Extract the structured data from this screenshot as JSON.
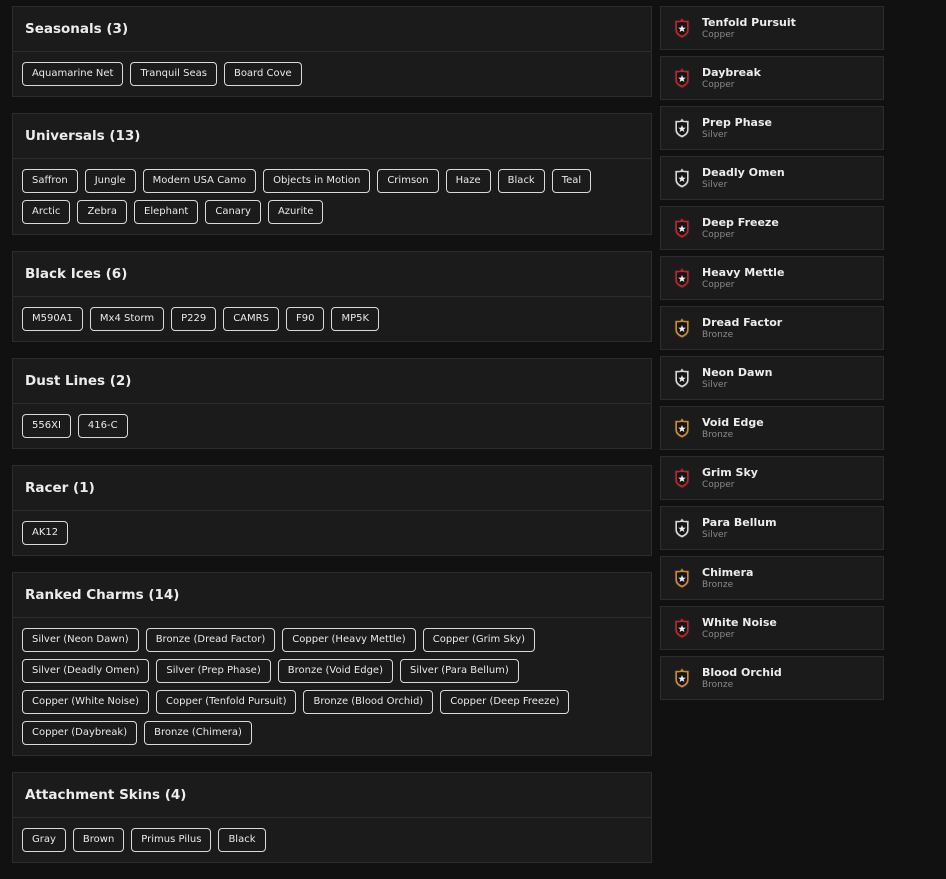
{
  "sections": [
    {
      "title": "Seasonals (3)",
      "items": [
        "Aquamarine Net",
        "Tranquil Seas",
        "Board Cove"
      ]
    },
    {
      "title": "Universals (13)",
      "items": [
        "Saffron",
        "Jungle",
        "Modern USA Camo",
        "Objects in Motion",
        "Crimson",
        "Haze",
        "Black",
        "Teal",
        "Arctic",
        "Zebra",
        "Elephant",
        "Canary",
        "Azurite"
      ]
    },
    {
      "title": "Black Ices (6)",
      "items": [
        "M590A1",
        "Mx4 Storm",
        "P229",
        "CAMRS",
        "F90",
        "MP5K"
      ]
    },
    {
      "title": "Dust Lines (2)",
      "items": [
        "556XI",
        "416-C"
      ]
    },
    {
      "title": "Racer (1)",
      "items": [
        "AK12"
      ]
    },
    {
      "title": "Ranked Charms (14)",
      "items": [
        "Silver (Neon Dawn)",
        "Bronze (Dread Factor)",
        "Copper (Heavy Mettle)",
        "Copper (Grim Sky)",
        "Silver (Deadly Omen)",
        "Silver (Prep Phase)",
        "Bronze (Void Edge)",
        "Silver (Para Bellum)",
        "Copper (White Noise)",
        "Copper (Tenfold Pursuit)",
        "Bronze (Blood Orchid)",
        "Copper (Deep Freeze)",
        "Copper (Daybreak)",
        "Bronze (Chimera)"
      ]
    },
    {
      "title": "Attachment Skins (4)",
      "items": [
        "Gray",
        "Brown",
        "Primus Pilus",
        "Black"
      ]
    }
  ],
  "charms": [
    {
      "name": "Tenfold Pursuit",
      "tier": "Copper"
    },
    {
      "name": "Daybreak",
      "tier": "Copper"
    },
    {
      "name": "Prep Phase",
      "tier": "Silver"
    },
    {
      "name": "Deadly Omen",
      "tier": "Silver"
    },
    {
      "name": "Deep Freeze",
      "tier": "Copper"
    },
    {
      "name": "Heavy Mettle",
      "tier": "Copper"
    },
    {
      "name": "Dread Factor",
      "tier": "Bronze"
    },
    {
      "name": "Neon Dawn",
      "tier": "Silver"
    },
    {
      "name": "Void Edge",
      "tier": "Bronze"
    },
    {
      "name": "Grim Sky",
      "tier": "Copper"
    },
    {
      "name": "Para Bellum",
      "tier": "Silver"
    },
    {
      "name": "Chimera",
      "tier": "Bronze"
    },
    {
      "name": "White Noise",
      "tier": "Copper"
    },
    {
      "name": "Blood Orchid",
      "tier": "Bronze"
    }
  ],
  "tier_colors": {
    "Copper": "#c8202a",
    "Silver": "#d6d6d6",
    "Bronze": "#d08a2c"
  }
}
